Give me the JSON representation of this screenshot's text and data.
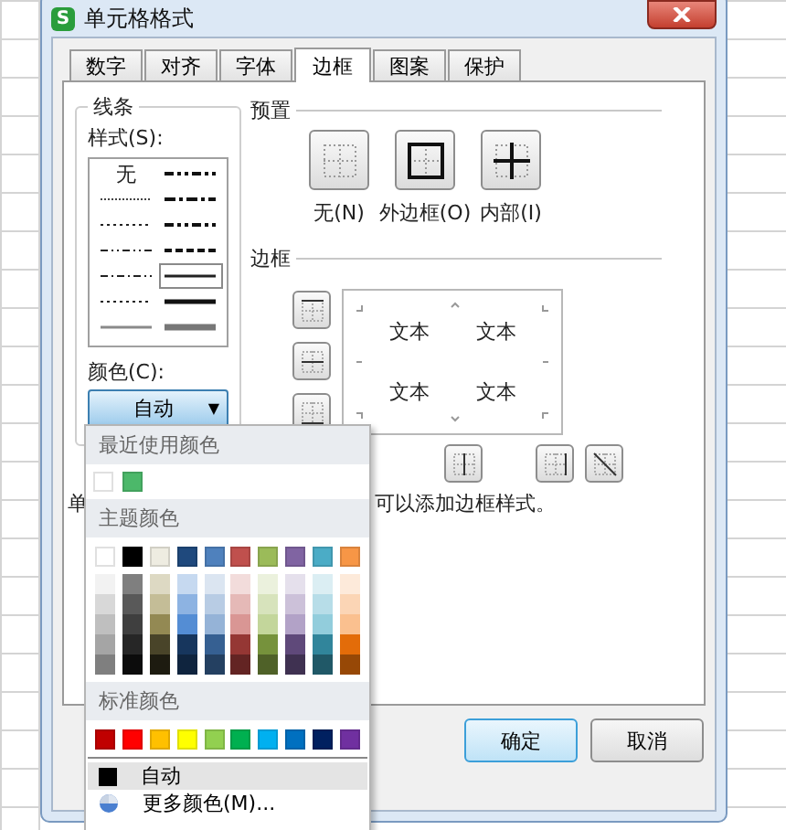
{
  "window": {
    "title": "单元格格式",
    "app_icon": "S"
  },
  "tabs": [
    {
      "label": "数字",
      "selected": false
    },
    {
      "label": "对齐",
      "selected": false
    },
    {
      "label": "字体",
      "selected": false
    },
    {
      "label": "边框",
      "selected": true
    },
    {
      "label": "图案",
      "selected": false
    },
    {
      "label": "保护",
      "selected": false
    }
  ],
  "line_group": {
    "title": "线条",
    "style_label": "样式(S):",
    "styles": [
      {
        "kind": "none",
        "label": "无",
        "selected": false
      },
      {
        "kind": "medium_dashdotdot",
        "selected": false
      },
      {
        "kind": "hair",
        "selected": false
      },
      {
        "kind": "medium_dashdot",
        "selected": false
      },
      {
        "kind": "dotted",
        "selected": false
      },
      {
        "kind": "medium_dashdotdot",
        "selected": false
      },
      {
        "kind": "dashdotdot",
        "selected": false
      },
      {
        "kind": "medium_dashed",
        "selected": false
      },
      {
        "kind": "dashdot",
        "selected": false
      },
      {
        "kind": "thin",
        "selected": true
      },
      {
        "kind": "dotted",
        "selected": false
      },
      {
        "kind": "medium",
        "selected": false
      },
      {
        "kind": "thin_grey",
        "selected": false
      },
      {
        "kind": "thick_grey",
        "selected": false
      }
    ],
    "color_label": "颜色(C):",
    "color_value": "自动",
    "dropdown_arrow": "▼"
  },
  "preset": {
    "title": "预置",
    "items": [
      {
        "kind": "none",
        "label": "无(N)"
      },
      {
        "kind": "outline",
        "label": "外边框(O)"
      },
      {
        "kind": "inside",
        "label": "内部(I)"
      }
    ]
  },
  "border": {
    "title": "边框",
    "side_buttons": [
      {
        "kind": "top"
      },
      {
        "kind": "middle"
      },
      {
        "kind": "bottom"
      }
    ],
    "sample_texts": [
      "文本",
      "文本",
      "文本",
      "文本"
    ],
    "bottom_buttons": [
      {
        "kind": "vertical_middle"
      },
      {
        "kind": "right"
      },
      {
        "kind": "diagonal"
      }
    ]
  },
  "hint": [
    "单",
    "可以添加边框样式。"
  ],
  "buttons": [
    {
      "label": "确定",
      "default": true
    },
    {
      "label": "取消",
      "default": false
    }
  ],
  "color_menu": {
    "recent": {
      "title": "最近使用颜色",
      "colors": [
        {
          "color": "#ffffff"
        },
        {
          "color": "#4cb86a"
        }
      ]
    },
    "theme": {
      "title": "主题颜色",
      "base": [
        {
          "color": "#ffffff"
        },
        {
          "color": "#000000"
        },
        {
          "color": "#eeece1"
        },
        {
          "color": "#1f497d"
        },
        {
          "color": "#4f81bd"
        },
        {
          "color": "#c0504d"
        },
        {
          "color": "#9bbb59"
        },
        {
          "color": "#8064a2"
        },
        {
          "color": "#4bacc6"
        },
        {
          "color": "#f79646"
        }
      ],
      "shades": [
        [
          {
            "color": "#f2f2f2"
          },
          {
            "color": "#7f7f7f"
          },
          {
            "color": "#ddd9c3"
          },
          {
            "color": "#c6d9f0"
          },
          {
            "color": "#dbe5f1"
          },
          {
            "color": "#f2dcdb"
          },
          {
            "color": "#ebf1dd"
          },
          {
            "color": "#e5e0ec"
          },
          {
            "color": "#dbeef3"
          },
          {
            "color": "#fdeada"
          }
        ],
        [
          {
            "color": "#d8d8d8"
          },
          {
            "color": "#595959"
          },
          {
            "color": "#c4bd97"
          },
          {
            "color": "#8db3e2"
          },
          {
            "color": "#b8cce4"
          },
          {
            "color": "#e5b9b7"
          },
          {
            "color": "#d7e3bc"
          },
          {
            "color": "#ccc1d9"
          },
          {
            "color": "#b7dde8"
          },
          {
            "color": "#fbd5b5"
          }
        ],
        [
          {
            "color": "#bfbfbf"
          },
          {
            "color": "#3f3f3f"
          },
          {
            "color": "#938953"
          },
          {
            "color": "#548dd4"
          },
          {
            "color": "#95b3d7"
          },
          {
            "color": "#d99694"
          },
          {
            "color": "#c3d69b"
          },
          {
            "color": "#b2a2c7"
          },
          {
            "color": "#92cddc"
          },
          {
            "color": "#fac08f"
          }
        ],
        [
          {
            "color": "#a5a5a5"
          },
          {
            "color": "#262626"
          },
          {
            "color": "#494429"
          },
          {
            "color": "#17365d"
          },
          {
            "color": "#366092"
          },
          {
            "color": "#953734"
          },
          {
            "color": "#76923c"
          },
          {
            "color": "#5f497a"
          },
          {
            "color": "#31859b"
          },
          {
            "color": "#e36c09"
          }
        ],
        [
          {
            "color": "#7f7f7f"
          },
          {
            "color": "#0c0c0c"
          },
          {
            "color": "#1d1b10"
          },
          {
            "color": "#0f243e"
          },
          {
            "color": "#244061"
          },
          {
            "color": "#632423"
          },
          {
            "color": "#4f6128"
          },
          {
            "color": "#3f3151"
          },
          {
            "color": "#205867"
          },
          {
            "color": "#974806"
          }
        ]
      ]
    },
    "standard": {
      "title": "标准颜色",
      "colors": [
        {
          "color": "#c00000"
        },
        {
          "color": "#ff0000"
        },
        {
          "color": "#ffc000"
        },
        {
          "color": "#ffff00"
        },
        {
          "color": "#92d050"
        },
        {
          "color": "#00b050"
        },
        {
          "color": "#00b0f0"
        },
        {
          "color": "#0070c0"
        },
        {
          "color": "#002060"
        },
        {
          "color": "#7030a0"
        }
      ]
    },
    "auto": {
      "label": "自动",
      "color": "#000000",
      "selected": true
    },
    "more": {
      "label": "更多颜色(M)..."
    }
  }
}
